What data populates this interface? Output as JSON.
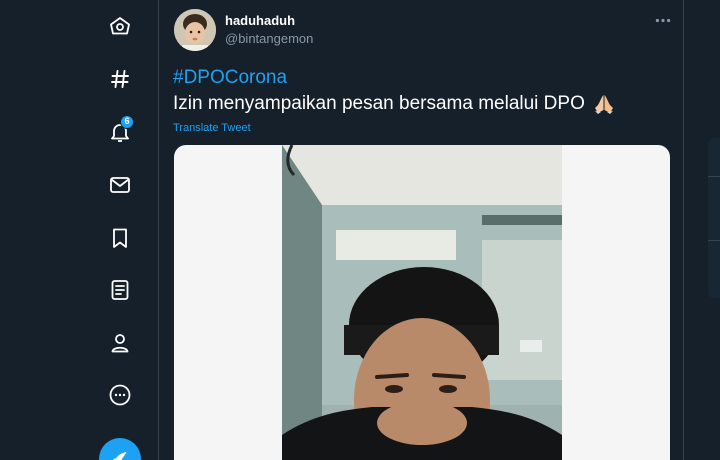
{
  "nav": {
    "items": [
      {
        "icon": "home-icon",
        "label": "Home"
      },
      {
        "icon": "explore-icon",
        "label": "Explore"
      },
      {
        "icon": "notifications-icon",
        "label": "Notifications",
        "badge": "6"
      },
      {
        "icon": "messages-icon",
        "label": "Messages"
      },
      {
        "icon": "bookmarks-icon",
        "label": "Bookmarks"
      },
      {
        "icon": "lists-icon",
        "label": "Lists"
      },
      {
        "icon": "profile-icon",
        "label": "Profile"
      },
      {
        "icon": "more-icon",
        "label": "More"
      }
    ],
    "compose_icon": "compose-tweet-icon"
  },
  "tweet": {
    "display_name": "haduhaduh",
    "handle": "@bintangemon",
    "hashtag": "#DPOCorona",
    "text": "Izin menyampaikan pesan bersama melalui DPO",
    "emoji": "folded-hands",
    "translate_label": "Translate Tweet",
    "more_icon": "ellipsis-icon"
  },
  "colors": {
    "background": "#15202b",
    "accent": "#1da1f2",
    "border": "#38444d",
    "secondary_text": "#8899a6"
  }
}
